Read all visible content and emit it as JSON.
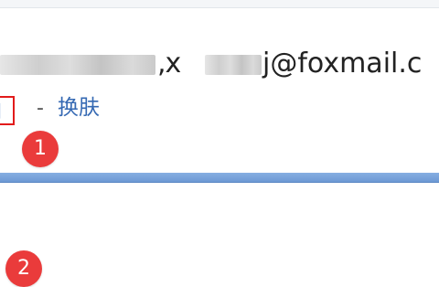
{
  "account": {
    "fragment_before": ",x",
    "fragment_after": "j@foxmail.c"
  },
  "menu": {
    "separator": "-",
    "skin_link": "换肤"
  },
  "annotations": {
    "marker_1": "1",
    "marker_2": "2"
  },
  "colors": {
    "accent_blue": "#6d99d4",
    "link_blue": "#3569b3",
    "marker_red": "#ea3b3b"
  }
}
